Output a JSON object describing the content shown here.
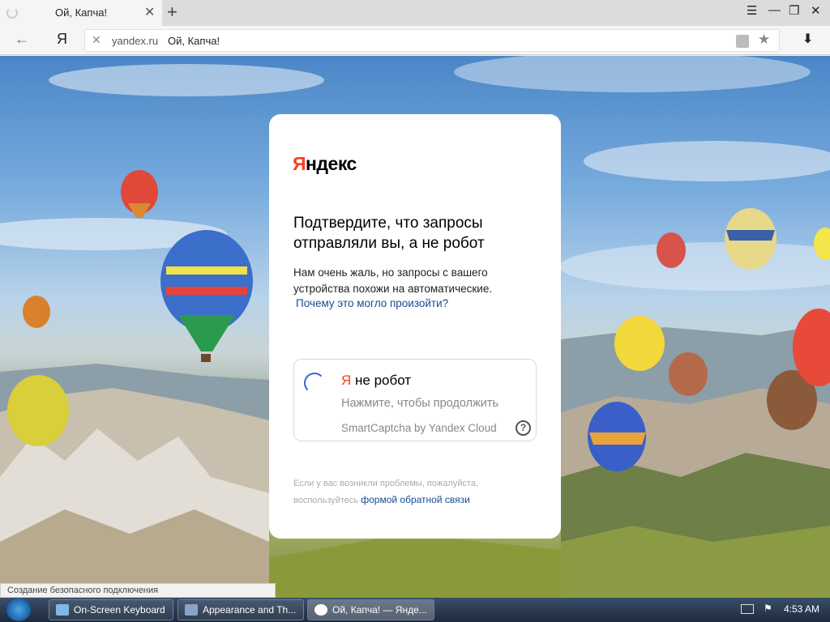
{
  "browser": {
    "tab_title": "Ой, Капча!",
    "new_tab_label": "+",
    "address_domain": "yandex.ru",
    "address_title": "Ой, Капча!",
    "yandex_button_label": "Я",
    "back_label": "←",
    "tab_close_label": "✕",
    "url_clear_label": "✕",
    "star_label": "★",
    "download_label": "⬇",
    "window_controls": [
      "☰",
      "—",
      "❐",
      "✕"
    ]
  },
  "captcha_page": {
    "logo_first": "Я",
    "logo_rest": "ндекс",
    "title": "Подтвердите, что запросы отправляли вы, а не робот",
    "text": "Нам очень жаль, но запросы с вашего устройства похожи на автоматические.",
    "why_link": "Почему это могло произойти?",
    "captcha": {
      "title_ya": "Я",
      "title_rest": " не робот",
      "hint": "Нажмите, чтобы продолжить",
      "brand": "SmartCaptcha by Yandex Cloud",
      "help_label": "?"
    },
    "footer_text": "Если у вас возникли проблемы, пожалуйста, воспользуйтесь ",
    "footer_link": "формой обратной связи"
  },
  "status_bar": "Создание безопасного подключения",
  "taskbar": {
    "tasks": [
      {
        "label": "On-Screen Keyboard",
        "icon": "keyboard-icon"
      },
      {
        "label": "Appearance and Th...",
        "icon": "control-panel-icon"
      },
      {
        "label": "Ой, Капча! — Янде...",
        "icon": "yandex-browser-icon"
      }
    ],
    "clock": "4:53 AM"
  },
  "colors": {
    "yandex_red": "#fc3f1d",
    "link_blue": "#1a4a95",
    "spinner_blue": "#3b63d8"
  }
}
